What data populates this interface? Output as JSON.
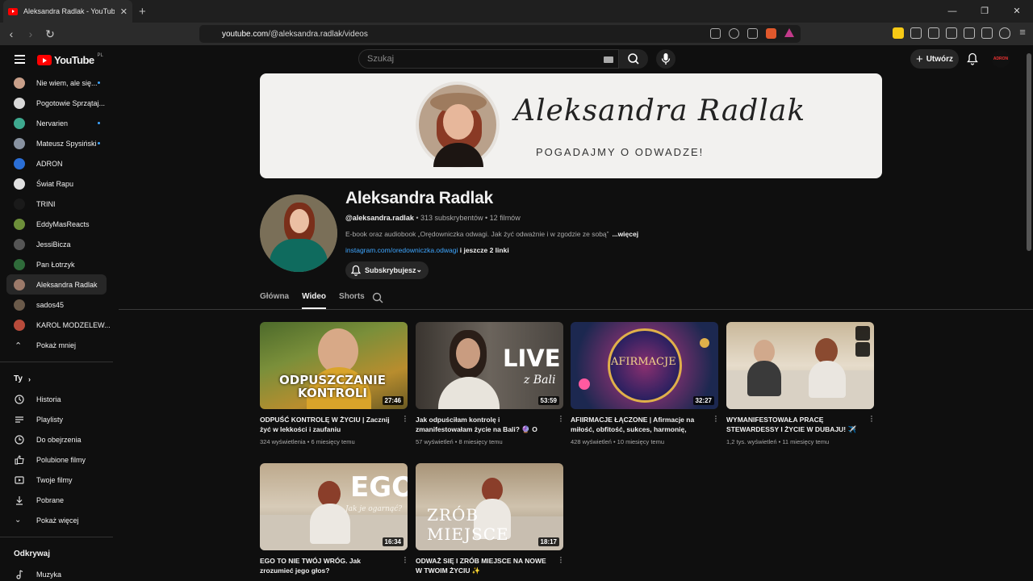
{
  "browser": {
    "tab_title": "Aleksandra Radlak - YouTube",
    "url_host": "youtube.com",
    "url_path": "/@aleksandra.radlak/videos"
  },
  "header": {
    "logo_text": "YouTube",
    "region": "PL",
    "search_placeholder": "Szukaj",
    "create_label": "Utwórz",
    "avatar_text": "ADRON"
  },
  "sidebar": {
    "subscriptions": [
      {
        "label": "Nie wiem, ale się...",
        "color": "#c9a08a",
        "new": true
      },
      {
        "label": "Pogotowie Sprzątaj...",
        "color": "#d8d8d8",
        "new": false
      },
      {
        "label": "Nervarien",
        "color": "#3ea98f",
        "new": true
      },
      {
        "label": "Mateusz Spysiński",
        "color": "#8892a0",
        "new": true
      },
      {
        "label": "ADRON",
        "color": "#2b6fd6",
        "new": false
      },
      {
        "label": "Świat Rapu",
        "color": "#e0e0e0",
        "new": false
      },
      {
        "label": "TRINI",
        "color": "#1a1a1a",
        "new": false
      },
      {
        "label": "EddyMasReacts",
        "color": "#6d8f3a",
        "new": false
      },
      {
        "label": "JessiBicza",
        "color": "#555555",
        "new": false
      },
      {
        "label": "Pan Łotrzyk",
        "color": "#2f6b3a",
        "new": false
      },
      {
        "label": "Aleksandra Radlak",
        "color": "#9c7a6a",
        "new": false
      },
      {
        "label": "sados45",
        "color": "#6a5a4a",
        "new": false
      },
      {
        "label": "KAROL MODZELEW...",
        "color": "#b84b3b",
        "new": false
      }
    ],
    "show_less": "Pokaż mniej",
    "you_heading": "Ty",
    "you_items": [
      {
        "label": "Historia",
        "icon": "history-icon"
      },
      {
        "label": "Playlisty",
        "icon": "playlist-icon"
      },
      {
        "label": "Do obejrzenia",
        "icon": "clock-icon"
      },
      {
        "label": "Polubione filmy",
        "icon": "thumb-up-icon"
      },
      {
        "label": "Twoje filmy",
        "icon": "video-icon"
      },
      {
        "label": "Pobrane",
        "icon": "download-icon"
      }
    ],
    "show_more": "Pokaż więcej",
    "explore_heading": "Odkrywaj",
    "explore_items": [
      {
        "label": "Muzyka",
        "icon": "music-icon"
      }
    ]
  },
  "channel": {
    "banner_signature": "Aleksandra Radlak",
    "banner_tagline": "POGADAJMY O ODWADZE!",
    "name": "Aleksandra Radlak",
    "handle": "@aleksandra.radlak",
    "meta": " • 313 subskrybentów • 12 filmów",
    "description": "E-book oraz audiobook „Orędowniczka odwagi. Jak żyć odważnie i w zgodzie ze sobą”",
    "more": "...więcej",
    "link": "instagram.com/oredowniczka.odwagi",
    "more_links": " i jeszcze 2 linki",
    "subscribe_label": "Subskrybujesz"
  },
  "tabs": [
    {
      "label": "Główna",
      "active": false
    },
    {
      "label": "Wideo",
      "active": true
    },
    {
      "label": "Shorts",
      "active": false
    }
  ],
  "videos": [
    {
      "title": "ODPUŚĆ KONTROLĘ W ŻYCIU | Zacznij żyć w lekkości i zaufaniu",
      "meta": "324 wyświetlenia • 6 miesięcy temu",
      "duration": "27:46",
      "thumb_text": "ODPUSZCZANIE KONTROLI"
    },
    {
      "title": "Jak odpuściłam kontrolę i zmanifestowałam życie na Bali? 🔮 O świadomej manifestacj...",
      "meta": "57 wyświetleń • 8 miesięcy temu",
      "duration": "53:59",
      "thumb_text": "LIVE",
      "thumb_sub": "z Bali"
    },
    {
      "title": "AFIIRMACJE ŁĄCZONE | Afirmacje na miłość, obfitość, sukces, harmonię, zdrowi...",
      "meta": "428 wyświetleń • 10 miesięcy temu",
      "duration": "32:27",
      "thumb_text": "AFIRMACJE"
    },
    {
      "title": "WYMANIFESTOWAŁA PRACĘ STEWARDESSY I ŻYCIE W DUBAJU! ✈️ ✨...",
      "meta": "1,2 tys. wyświetleń • 11 miesięcy temu",
      "duration": "",
      "thumb_text": ""
    },
    {
      "title": "EGO TO NIE TWÓJ WRÓG. Jak zrozumieć jego głos?",
      "meta": "",
      "duration": "16:34",
      "thumb_text": "EGO",
      "thumb_sub": "Jak je ogarnąć?"
    },
    {
      "title": "ODWAŻ SIĘ I ZRÓB MIEJSCE NA NOWE W TWOIM ŻYCIU ✨",
      "meta": "",
      "duration": "18:17",
      "thumb_text": "ZRÓB MIEJSCE"
    }
  ]
}
